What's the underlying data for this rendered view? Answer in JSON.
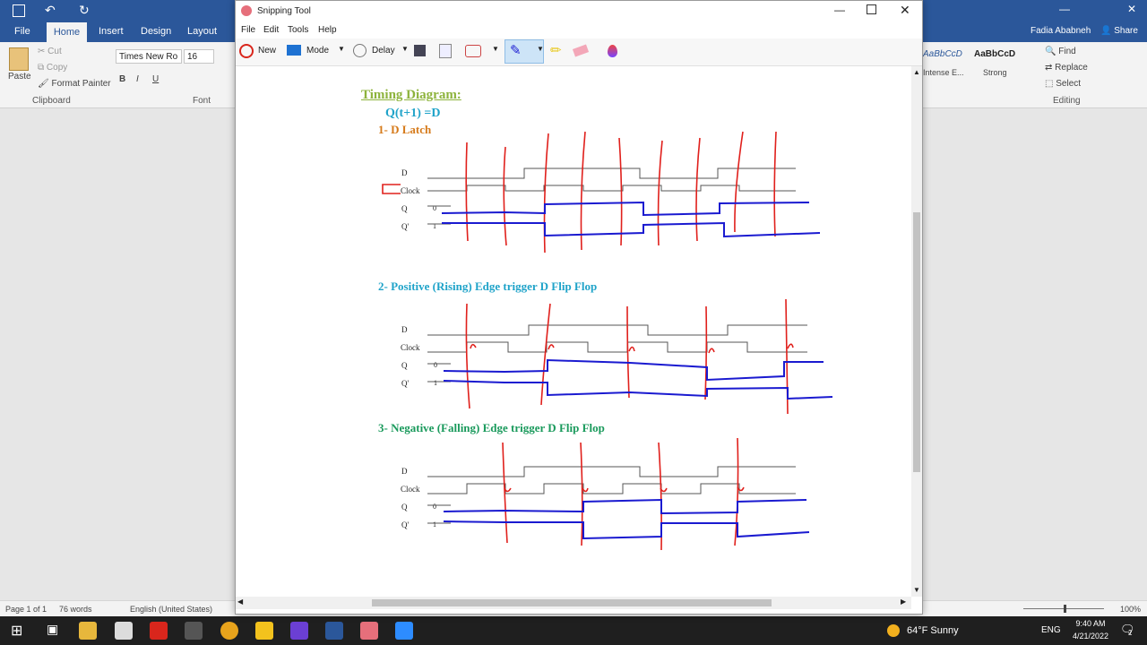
{
  "word": {
    "tabs": [
      "File",
      "Home",
      "Insert",
      "Design",
      "Layout"
    ],
    "user": "Fadia Ababneh",
    "share_label": "Share",
    "clipboard": {
      "paste": "Paste",
      "cut": "Cut",
      "copy": "Copy",
      "format_painter": "Format Painter",
      "group": "Clipboard"
    },
    "font": {
      "name": "Times New Ro",
      "size": "16",
      "group": "Font"
    },
    "styles": [
      {
        "preview": "AaBbCcD",
        "name": "Intense E..."
      },
      {
        "preview": "AaBbCcD",
        "name": "Strong"
      }
    ],
    "editing": {
      "find": "Find",
      "replace": "Replace",
      "select": "Select",
      "group": "Editing"
    },
    "status": {
      "page": "Page 1 of 1",
      "words": "76 words",
      "language": "English (United States)",
      "zoom": "100%"
    }
  },
  "snip": {
    "title": "Snipping Tool",
    "menu": [
      "File",
      "Edit",
      "Tools",
      "Help"
    ],
    "toolbar": {
      "new": "New",
      "mode": "Mode",
      "delay": "Delay"
    }
  },
  "document": {
    "heading": "Timing Diagram:",
    "equation": "Q(t+1) =D",
    "sec1": "1-  D Latch",
    "sec2": "2-  Positive (Rising) Edge trigger D Flip Flop",
    "sec3": "3-  Negative (Falling) Edge trigger D Flip Flop",
    "signals": [
      "D",
      "Clock",
      "Q",
      "Q'"
    ],
    "q_init": "0",
    "qbar_init": "1"
  },
  "taskbar": {
    "weather": "64°F  Sunny",
    "lang": "ENG",
    "time": "9:40 AM",
    "date": "4/21/2022",
    "notifications": "2"
  },
  "colors": {
    "word_blue": "#2b579a",
    "heading_green": "#8db33c",
    "cyan": "#1fa3c9",
    "orange": "#d67a1a",
    "green": "#1a9a5c",
    "ink_red": "#e0201c",
    "ink_blue": "#1a1ad0"
  }
}
